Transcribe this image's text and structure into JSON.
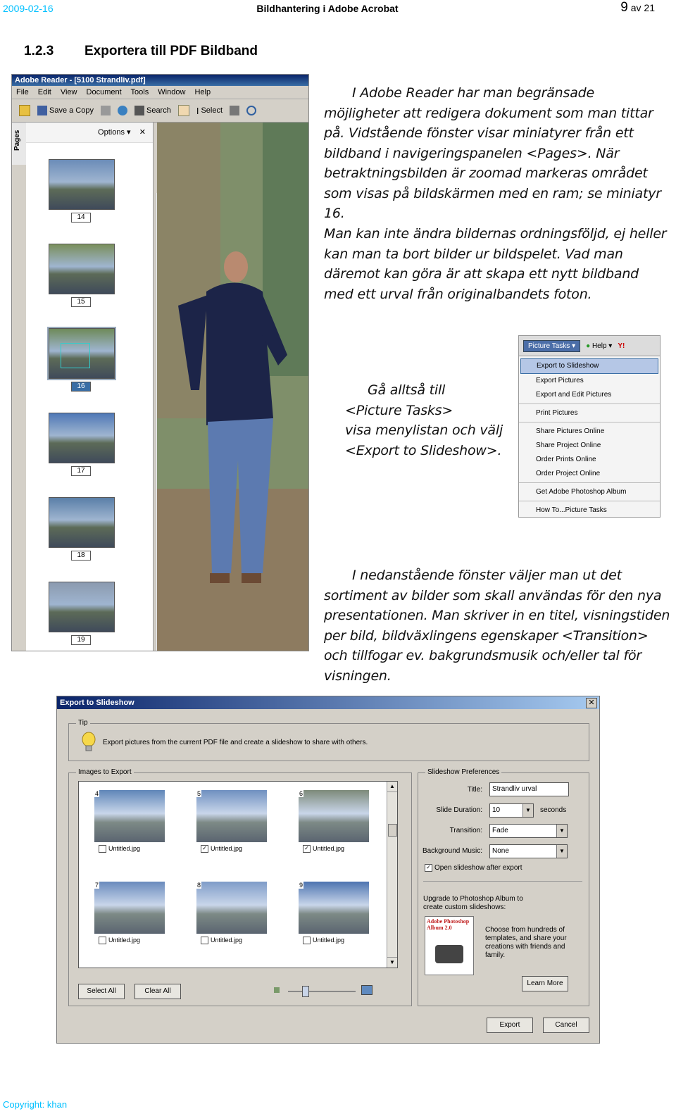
{
  "header": {
    "date": "2009-02-16",
    "title": "Bildhantering i Adobe Acrobat",
    "page_number": "9",
    "page_of": "av 21"
  },
  "section": {
    "number": "1.2.3",
    "title": "Exportera till PDF Bildband"
  },
  "paragraphs": {
    "p1": "I Adobe Reader har man begränsade möjligheter att redigera dokument som man tittar på. Vidstående fönster visar miniatyrer från ett bildband i navigeringspanelen <Pages>. När betraktningsbilden är zoomad markeras området som visas på bildskärmen med en ram; se miniatyr 16.",
    "p2": "Man kan inte ändra bildernas ordningsföljd, ej heller kan man ta bort bilder ur bildspelet. Vad man däremot kan göra är att skapa ett nytt bildband med ett urval från originalbandets foton.",
    "p3a": "Gå alltså till",
    "p3b": "<Picture Tasks>",
    "p3c": "visa menylistan och välj",
    "p3d": "<Export to Slideshow>.",
    "p4": "I nedanstående fönster väljer man ut det sortiment av bilder som skall användas för den nya presentationen. Man skriver in en titel, visningstiden per bild, bildväxlingens egenskaper <Transition> och tillfogar ev. bakgrundsmusik och/eller tal för visningen."
  },
  "reader": {
    "title": "Adobe Reader - [5100 Strandliv.pdf]",
    "menu": [
      "File",
      "Edit",
      "View",
      "Document",
      "Tools",
      "Window",
      "Help"
    ],
    "toolbar": {
      "save": "Save a Copy",
      "search": "Search",
      "select": "Select"
    },
    "pages_tab": "Pages",
    "options": "Options",
    "close": "✕",
    "thumbs": [
      {
        "label": "14",
        "color": "#6b8cb8"
      },
      {
        "label": "15",
        "color": "#7a8f5c"
      },
      {
        "label": "16",
        "color": "#6e8a5a"
      },
      {
        "label": "17",
        "color": "#4f78b6"
      },
      {
        "label": "18",
        "color": "#5a7fa8"
      },
      {
        "label": "19",
        "color": "#8b9aaf"
      }
    ]
  },
  "picture_tasks": {
    "tab": "Picture Tasks",
    "help": "Help",
    "brand": "Y!",
    "items": [
      {
        "label": "Export to Slideshow",
        "highlight": true
      },
      {
        "label": "Export Pictures"
      },
      {
        "label": "Export and Edit Pictures",
        "sep_after": true
      },
      {
        "label": "Print Pictures",
        "sep_after": true
      },
      {
        "label": "Share Pictures Online"
      },
      {
        "label": "Share Project Online"
      },
      {
        "label": "Order Prints Online"
      },
      {
        "label": "Order Project Online",
        "sep_after": true
      },
      {
        "label": "Get Adobe Photoshop Album",
        "sep_after": true
      },
      {
        "label": "How To...Picture Tasks"
      }
    ]
  },
  "dialog": {
    "title": "Export to Slideshow",
    "close": "✕",
    "tip_group": "Tip",
    "tip_text": "Export pictures from the current PDF file and create a slideshow to share with others.",
    "images_group": "Images to Export",
    "images": [
      {
        "num": "4",
        "caption": "Untitled.jpg",
        "checked": false,
        "color": "#5f86b8"
      },
      {
        "num": "5",
        "caption": "Untitled.jpg",
        "checked": true,
        "color": "#6f90c0"
      },
      {
        "num": "6",
        "caption": "Untitled.jpg",
        "checked": true,
        "color": "#7d8a7a"
      },
      {
        "num": "7",
        "caption": "Untitled.jpg",
        "checked": false,
        "color": "#6a8bbd"
      },
      {
        "num": "8",
        "caption": "Untitled.jpg",
        "checked": false,
        "color": "#7f9cc8"
      },
      {
        "num": "9",
        "caption": "Untitled.jpg",
        "checked": false,
        "color": "#4d74b0"
      }
    ],
    "select_all": "Select All",
    "clear_all": "Clear All",
    "prefs_group": "Slideshow Preferences",
    "title_label": "Title:",
    "title_value": "Strandliv urval",
    "duration_label": "Slide Duration:",
    "duration_value": "10",
    "duration_unit": "seconds",
    "transition_label": "Transition:",
    "transition_value": "Fade",
    "music_label": "Background Music:",
    "music_value": "None",
    "open_after": "Open slideshow after export",
    "open_after_checked": true,
    "upgrade_title": "Upgrade to Photoshop Album to create custom slideshows:",
    "upgrade_text": "Choose from hundreds of templates, and share your creations with friends and family.",
    "album_brand": "Adobe Photoshop Album 2.0",
    "learn_more": "Learn More",
    "export": "Export",
    "cancel": "Cancel"
  },
  "footer": {
    "copyright": "Copyright: khan"
  }
}
